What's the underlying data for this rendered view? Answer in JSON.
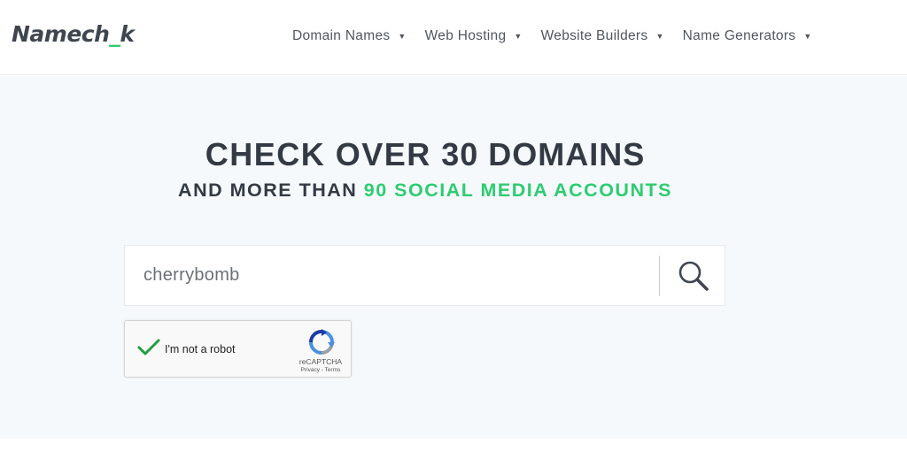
{
  "header": {
    "logo": {
      "part1": "Namech",
      "accent": "_",
      "part2": "k"
    },
    "nav": [
      {
        "label": "Domain Names"
      },
      {
        "label": "Web Hosting"
      },
      {
        "label": "Website Builders"
      },
      {
        "label": "Name Generators"
      }
    ]
  },
  "hero": {
    "headline_light": "CHECK OVER ",
    "headline_bold": "30 DOMAINS",
    "subline_dark": "AND MORE THAN ",
    "subline_green": "90 SOCIAL MEDIA ACCOUNTS"
  },
  "search": {
    "value": "cherrybomb",
    "icon": "search-icon"
  },
  "recaptcha": {
    "label": "I'm not a robot",
    "brand": "reCAPTCHA",
    "privacy": "Privacy",
    "separator": " - ",
    "terms": "Terms",
    "checked": true
  },
  "colors": {
    "accent_green": "#2ecc71",
    "text_dark": "#333a44",
    "hero_background": "#f6f9fc"
  }
}
